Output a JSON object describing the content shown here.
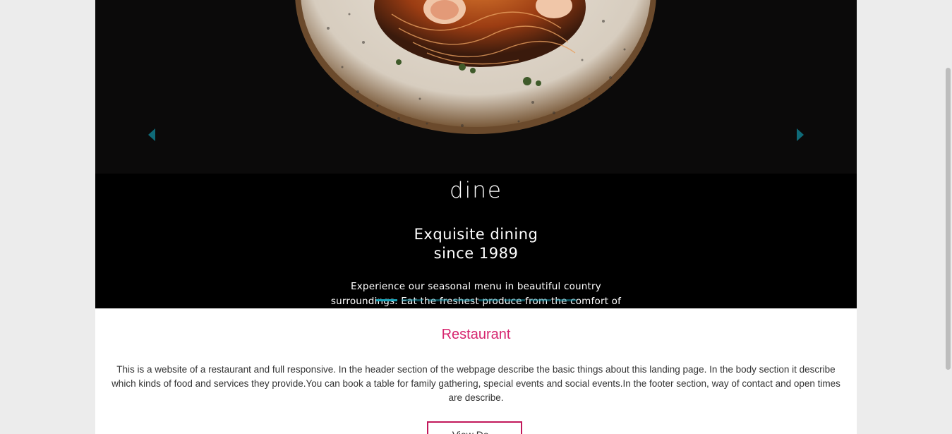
{
  "carousel": {
    "prev_icon": "chevron-left-icon",
    "next_icon": "chevron-right-icon",
    "brand": "dine",
    "headline_line1": "Exquisite dining",
    "headline_line2": "since 1989",
    "lede_line1": "Experience our seasonal menu in beautiful country",
    "lede_line2": "surroundings. Eat the freshest produce from the comfort of",
    "indicator_count": 8,
    "active_indicator": 1,
    "indicator_color": "#17a2b8",
    "arrow_color": "#0f6a78"
  },
  "section": {
    "title": "Restaurant",
    "title_color": "#d6246e",
    "description": "This is a website of a restaurant and full responsive. In the header section of the webpage describe the basic things about this landing page. In the body section it describe which kinds of food and services they provide.You can book a table for family gathering, special events and social events.In the footer section, way of contact and open times are describe.",
    "button_label": "View Do...",
    "button_border_color": "#c2185b"
  }
}
